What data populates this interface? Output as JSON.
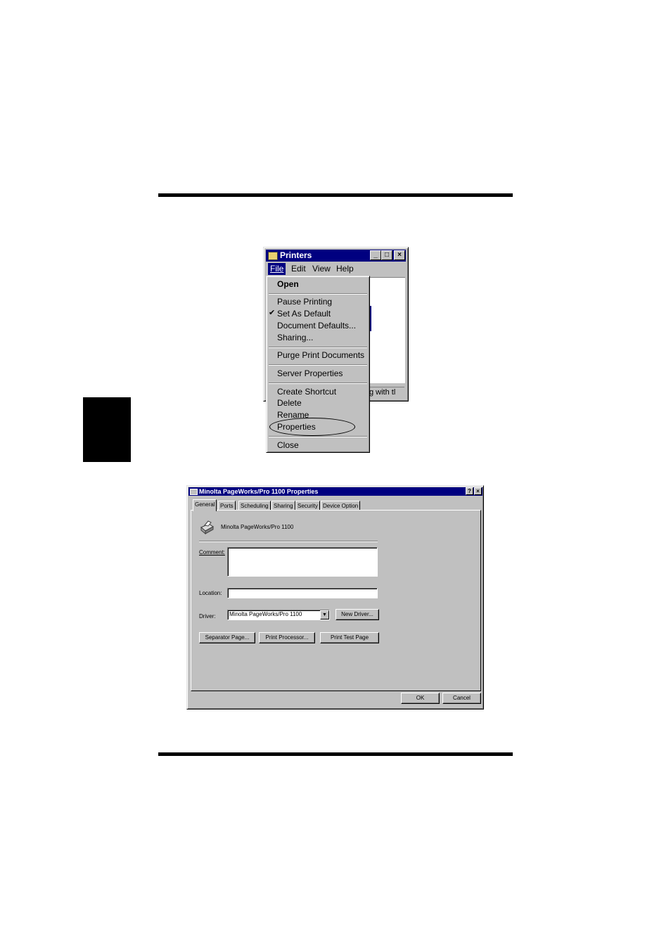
{
  "printers_window": {
    "title": "Printers",
    "menubar": [
      "File",
      "Edit",
      "View",
      "Help"
    ],
    "status_text": "g with tl"
  },
  "file_menu": {
    "open": "Open",
    "pause_printing": "Pause Printing",
    "set_as_default": "Set As Default",
    "document_defaults": "Document Defaults...",
    "sharing": "Sharing...",
    "purge": "Purge Print Documents",
    "server_properties": "Server Properties",
    "create_shortcut": "Create Shortcut",
    "delete": "Delete",
    "rename": "Rename",
    "properties": "Properties",
    "close": "Close"
  },
  "dialog": {
    "title": "Minolta PageWorks/Pro 1100 Properties",
    "tabs": [
      "General",
      "Ports",
      "Scheduling",
      "Sharing",
      "Security",
      "Device Option"
    ],
    "printer_name": "Minolta PageWorks/Pro 1100",
    "comment_label": "Comment:",
    "location_label": "Location:",
    "driver_label": "Driver:",
    "driver_value": "Minolta PageWorks/Pro 1100",
    "new_driver_button": "New Driver...",
    "separator_page_button": "Separator Page...",
    "print_processor_button": "Print Processor...",
    "print_test_page_button": "Print Test Page",
    "ok_button": "OK",
    "cancel_button": "Cancel"
  }
}
